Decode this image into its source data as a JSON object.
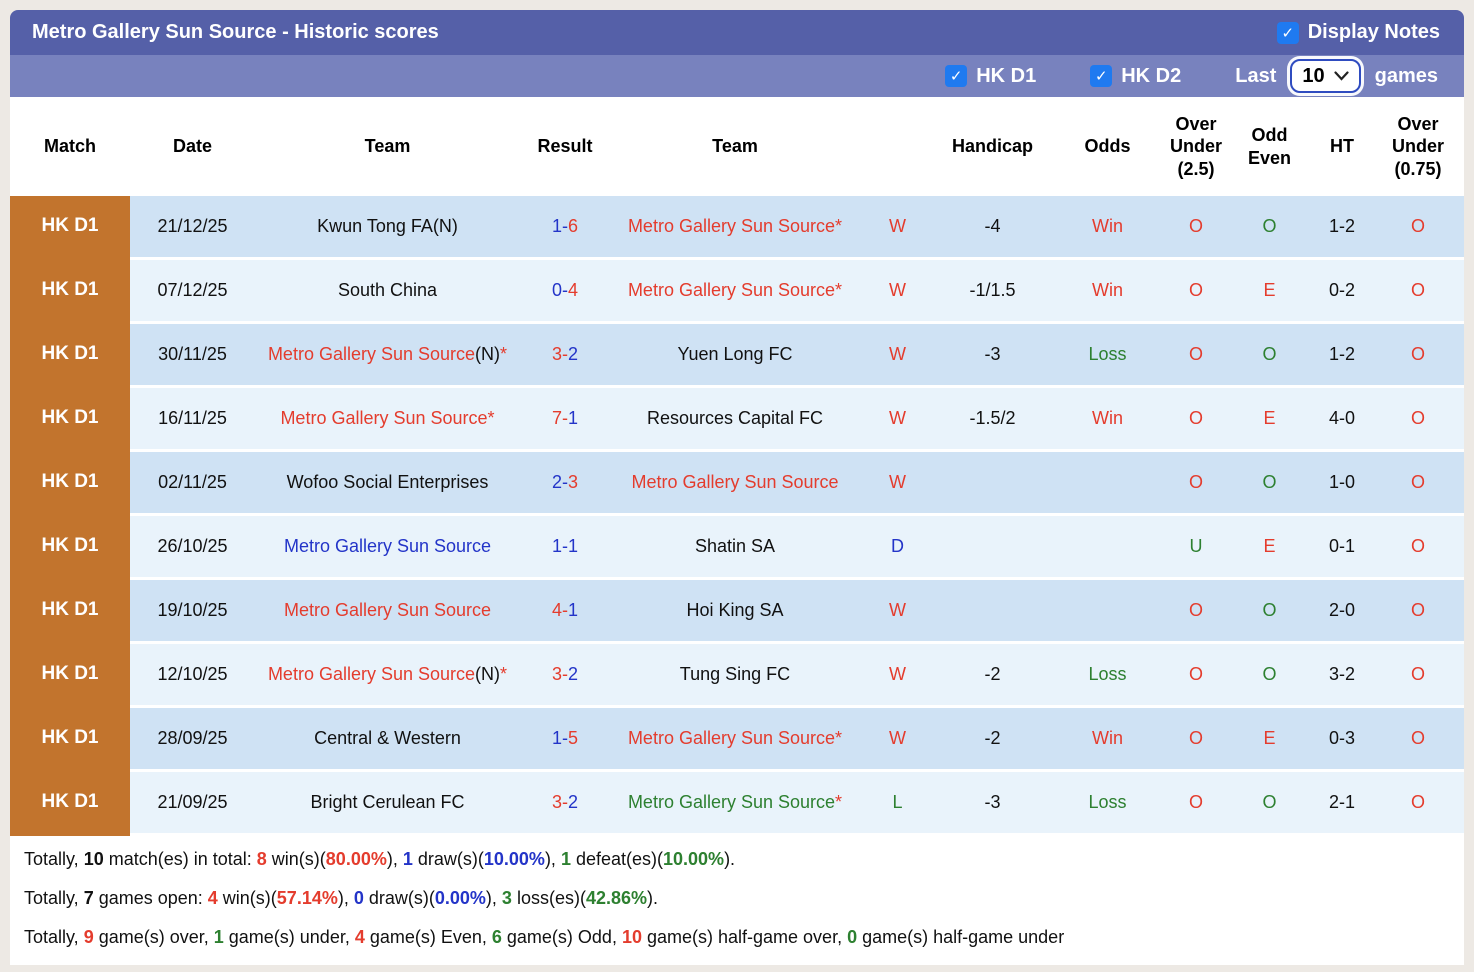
{
  "header": {
    "title": "Metro Gallery Sun Source - Historic scores",
    "display_notes_label": "Display Notes",
    "filters": {
      "league1": "HK D1",
      "league2": "HK D2",
      "last_label": "Last",
      "last_value": "10",
      "games_label": "games"
    }
  },
  "colors": {
    "accent_orange": "#c2742d",
    "bar_dark": "#5560a8",
    "bar_light": "#7882be",
    "checkbox_blue": "#1f7af0",
    "win_red": "#e43c2d",
    "draw_blue": "#2334c8",
    "loss_green": "#2d8030",
    "row_odd": "#cfe2f4",
    "row_even": "#e9f3fb"
  },
  "table": {
    "headers": [
      "Match",
      "Date",
      "Team",
      "Result",
      "Team",
      "",
      "Handicap",
      "Odds",
      "Over Under (2.5)",
      "Odd Even",
      "HT",
      "Over Under (0.75)"
    ],
    "rows": [
      {
        "match": "HK D1",
        "date": "21/12/25",
        "team1": [
          {
            "t": "Kwun Tong FA(N)",
            "c": "k"
          }
        ],
        "result": [
          {
            "t": "1-",
            "c": "b"
          },
          {
            "t": "6",
            "c": "r"
          }
        ],
        "team2": [
          {
            "t": "Metro Gallery Sun Source",
            "c": "r"
          },
          {
            "t": "*",
            "c": "r"
          }
        ],
        "wdl": [
          {
            "t": "W",
            "c": "r"
          }
        ],
        "handicap": "-4",
        "odds": [
          {
            "t": "Win",
            "c": "r"
          }
        ],
        "ou25": [
          {
            "t": "O",
            "c": "r"
          }
        ],
        "oddeven": [
          {
            "t": "O",
            "c": "g"
          }
        ],
        "ht": "1-2",
        "ou075": [
          {
            "t": "O",
            "c": "r"
          }
        ]
      },
      {
        "match": "HK D1",
        "date": "07/12/25",
        "team1": [
          {
            "t": "South China",
            "c": "k"
          }
        ],
        "result": [
          {
            "t": "0-",
            "c": "b"
          },
          {
            "t": "4",
            "c": "r"
          }
        ],
        "team2": [
          {
            "t": "Metro Gallery Sun Source",
            "c": "r"
          },
          {
            "t": "*",
            "c": "r"
          }
        ],
        "wdl": [
          {
            "t": "W",
            "c": "r"
          }
        ],
        "handicap": "-1/1.5",
        "odds": [
          {
            "t": "Win",
            "c": "r"
          }
        ],
        "ou25": [
          {
            "t": "O",
            "c": "r"
          }
        ],
        "oddeven": [
          {
            "t": "E",
            "c": "r"
          }
        ],
        "ht": "0-2",
        "ou075": [
          {
            "t": "O",
            "c": "r"
          }
        ]
      },
      {
        "match": "HK D1",
        "date": "30/11/25",
        "team1": [
          {
            "t": "Metro Gallery Sun Source",
            "c": "r"
          },
          {
            "t": "(N)",
            "c": "k"
          },
          {
            "t": "*",
            "c": "r"
          }
        ],
        "result": [
          {
            "t": "3-",
            "c": "r"
          },
          {
            "t": "2",
            "c": "b"
          }
        ],
        "team2": [
          {
            "t": "Yuen Long FC",
            "c": "k"
          }
        ],
        "wdl": [
          {
            "t": "W",
            "c": "r"
          }
        ],
        "handicap": "-3",
        "odds": [
          {
            "t": "Loss",
            "c": "g"
          }
        ],
        "ou25": [
          {
            "t": "O",
            "c": "r"
          }
        ],
        "oddeven": [
          {
            "t": "O",
            "c": "g"
          }
        ],
        "ht": "1-2",
        "ou075": [
          {
            "t": "O",
            "c": "r"
          }
        ]
      },
      {
        "match": "HK D1",
        "date": "16/11/25",
        "team1": [
          {
            "t": "Metro Gallery Sun Source",
            "c": "r"
          },
          {
            "t": "*",
            "c": "r"
          }
        ],
        "result": [
          {
            "t": "7-",
            "c": "r"
          },
          {
            "t": "1",
            "c": "b"
          }
        ],
        "team2": [
          {
            "t": "Resources Capital FC",
            "c": "k"
          }
        ],
        "wdl": [
          {
            "t": "W",
            "c": "r"
          }
        ],
        "handicap": "-1.5/2",
        "odds": [
          {
            "t": "Win",
            "c": "r"
          }
        ],
        "ou25": [
          {
            "t": "O",
            "c": "r"
          }
        ],
        "oddeven": [
          {
            "t": "E",
            "c": "r"
          }
        ],
        "ht": "4-0",
        "ou075": [
          {
            "t": "O",
            "c": "r"
          }
        ]
      },
      {
        "match": "HK D1",
        "date": "02/11/25",
        "team1": [
          {
            "t": "Wofoo Social Enterprises",
            "c": "k"
          }
        ],
        "result": [
          {
            "t": "2-",
            "c": "b"
          },
          {
            "t": "3",
            "c": "r"
          }
        ],
        "team2": [
          {
            "t": "Metro Gallery Sun Source",
            "c": "r"
          }
        ],
        "wdl": [
          {
            "t": "W",
            "c": "r"
          }
        ],
        "handicap": "",
        "odds": [],
        "ou25": [
          {
            "t": "O",
            "c": "r"
          }
        ],
        "oddeven": [
          {
            "t": "O",
            "c": "g"
          }
        ],
        "ht": "1-0",
        "ou075": [
          {
            "t": "O",
            "c": "r"
          }
        ]
      },
      {
        "match": "HK D1",
        "date": "26/10/25",
        "team1": [
          {
            "t": "Metro Gallery Sun Source",
            "c": "b"
          }
        ],
        "result": [
          {
            "t": "1-1",
            "c": "b"
          }
        ],
        "team2": [
          {
            "t": "Shatin SA",
            "c": "k"
          }
        ],
        "wdl": [
          {
            "t": "D",
            "c": "b"
          }
        ],
        "handicap": "",
        "odds": [],
        "ou25": [
          {
            "t": "U",
            "c": "g"
          }
        ],
        "oddeven": [
          {
            "t": "E",
            "c": "r"
          }
        ],
        "ht": "0-1",
        "ou075": [
          {
            "t": "O",
            "c": "r"
          }
        ]
      },
      {
        "match": "HK D1",
        "date": "19/10/25",
        "team1": [
          {
            "t": "Metro Gallery Sun Source",
            "c": "r"
          }
        ],
        "result": [
          {
            "t": "4-",
            "c": "r"
          },
          {
            "t": "1",
            "c": "b"
          }
        ],
        "team2": [
          {
            "t": "Hoi King SA",
            "c": "k"
          }
        ],
        "wdl": [
          {
            "t": "W",
            "c": "r"
          }
        ],
        "handicap": "",
        "odds": [],
        "ou25": [
          {
            "t": "O",
            "c": "r"
          }
        ],
        "oddeven": [
          {
            "t": "O",
            "c": "g"
          }
        ],
        "ht": "2-0",
        "ou075": [
          {
            "t": "O",
            "c": "r"
          }
        ]
      },
      {
        "match": "HK D1",
        "date": "12/10/25",
        "team1": [
          {
            "t": "Metro Gallery Sun Source",
            "c": "r"
          },
          {
            "t": "(N)",
            "c": "k"
          },
          {
            "t": "*",
            "c": "r"
          }
        ],
        "result": [
          {
            "t": "3-",
            "c": "r"
          },
          {
            "t": "2",
            "c": "b"
          }
        ],
        "team2": [
          {
            "t": "Tung Sing FC",
            "c": "k"
          }
        ],
        "wdl": [
          {
            "t": "W",
            "c": "r"
          }
        ],
        "handicap": "-2",
        "odds": [
          {
            "t": "Loss",
            "c": "g"
          }
        ],
        "ou25": [
          {
            "t": "O",
            "c": "r"
          }
        ],
        "oddeven": [
          {
            "t": "O",
            "c": "g"
          }
        ],
        "ht": "3-2",
        "ou075": [
          {
            "t": "O",
            "c": "r"
          }
        ]
      },
      {
        "match": "HK D1",
        "date": "28/09/25",
        "team1": [
          {
            "t": "Central & Western",
            "c": "k"
          }
        ],
        "result": [
          {
            "t": "1-",
            "c": "b"
          },
          {
            "t": "5",
            "c": "r"
          }
        ],
        "team2": [
          {
            "t": "Metro Gallery Sun Source",
            "c": "r"
          },
          {
            "t": "*",
            "c": "r"
          }
        ],
        "wdl": [
          {
            "t": "W",
            "c": "r"
          }
        ],
        "handicap": "-2",
        "odds": [
          {
            "t": "Win",
            "c": "r"
          }
        ],
        "ou25": [
          {
            "t": "O",
            "c": "r"
          }
        ],
        "oddeven": [
          {
            "t": "E",
            "c": "r"
          }
        ],
        "ht": "0-3",
        "ou075": [
          {
            "t": "O",
            "c": "r"
          }
        ]
      },
      {
        "match": "HK D1",
        "date": "21/09/25",
        "team1": [
          {
            "t": "Bright Cerulean FC",
            "c": "k"
          }
        ],
        "result": [
          {
            "t": "3-",
            "c": "r"
          },
          {
            "t": "2",
            "c": "b"
          }
        ],
        "team2": [
          {
            "t": "Metro Gallery Sun Source",
            "c": "g"
          },
          {
            "t": "*",
            "c": "r"
          }
        ],
        "wdl": [
          {
            "t": "L",
            "c": "g"
          }
        ],
        "handicap": "-3",
        "odds": [
          {
            "t": "Loss",
            "c": "g"
          }
        ],
        "ou25": [
          {
            "t": "O",
            "c": "r"
          }
        ],
        "oddeven": [
          {
            "t": "O",
            "c": "g"
          }
        ],
        "ht": "2-1",
        "ou075": [
          {
            "t": "O",
            "c": "r"
          }
        ]
      }
    ]
  },
  "summary": {
    "lines": [
      [
        {
          "t": "Totally, ",
          "c": "k"
        },
        {
          "t": "10",
          "c": "k",
          "b": 1
        },
        {
          "t": " match(es) in total: ",
          "c": "k"
        },
        {
          "t": "8",
          "c": "r",
          "b": 1
        },
        {
          "t": " win(s)(",
          "c": "k"
        },
        {
          "t": "80.00%",
          "c": "r",
          "b": 1
        },
        {
          "t": "), ",
          "c": "k"
        },
        {
          "t": "1",
          "c": "b",
          "b": 1
        },
        {
          "t": " draw(s)(",
          "c": "k"
        },
        {
          "t": "10.00%",
          "c": "b",
          "b": 1
        },
        {
          "t": "), ",
          "c": "k"
        },
        {
          "t": "1",
          "c": "g",
          "b": 1
        },
        {
          "t": " defeat(es)(",
          "c": "k"
        },
        {
          "t": "10.00%",
          "c": "g",
          "b": 1
        },
        {
          "t": ").",
          "c": "k"
        }
      ],
      [
        {
          "t": "Totally, ",
          "c": "k"
        },
        {
          "t": "7",
          "c": "k",
          "b": 1
        },
        {
          "t": " games open: ",
          "c": "k"
        },
        {
          "t": "4",
          "c": "r",
          "b": 1
        },
        {
          "t": " win(s)(",
          "c": "k"
        },
        {
          "t": "57.14%",
          "c": "r",
          "b": 1
        },
        {
          "t": "), ",
          "c": "k"
        },
        {
          "t": "0",
          "c": "b",
          "b": 1
        },
        {
          "t": " draw(s)(",
          "c": "k"
        },
        {
          "t": "0.00%",
          "c": "b",
          "b": 1
        },
        {
          "t": "), ",
          "c": "k"
        },
        {
          "t": "3",
          "c": "g",
          "b": 1
        },
        {
          "t": " loss(es)(",
          "c": "k"
        },
        {
          "t": "42.86%",
          "c": "g",
          "b": 1
        },
        {
          "t": ").",
          "c": "k"
        }
      ],
      [
        {
          "t": "Totally, ",
          "c": "k"
        },
        {
          "t": "9",
          "c": "r",
          "b": 1
        },
        {
          "t": " game(s) over, ",
          "c": "k"
        },
        {
          "t": "1",
          "c": "g",
          "b": 1
        },
        {
          "t": " game(s) under, ",
          "c": "k"
        },
        {
          "t": "4",
          "c": "r",
          "b": 1
        },
        {
          "t": " game(s) Even, ",
          "c": "k"
        },
        {
          "t": "6",
          "c": "g",
          "b": 1
        },
        {
          "t": " game(s) Odd, ",
          "c": "k"
        },
        {
          "t": "10",
          "c": "r",
          "b": 1
        },
        {
          "t": " game(s) half-game over, ",
          "c": "k"
        },
        {
          "t": "0",
          "c": "g",
          "b": 1
        },
        {
          "t": " game(s) half-game under",
          "c": "k"
        }
      ]
    ]
  }
}
